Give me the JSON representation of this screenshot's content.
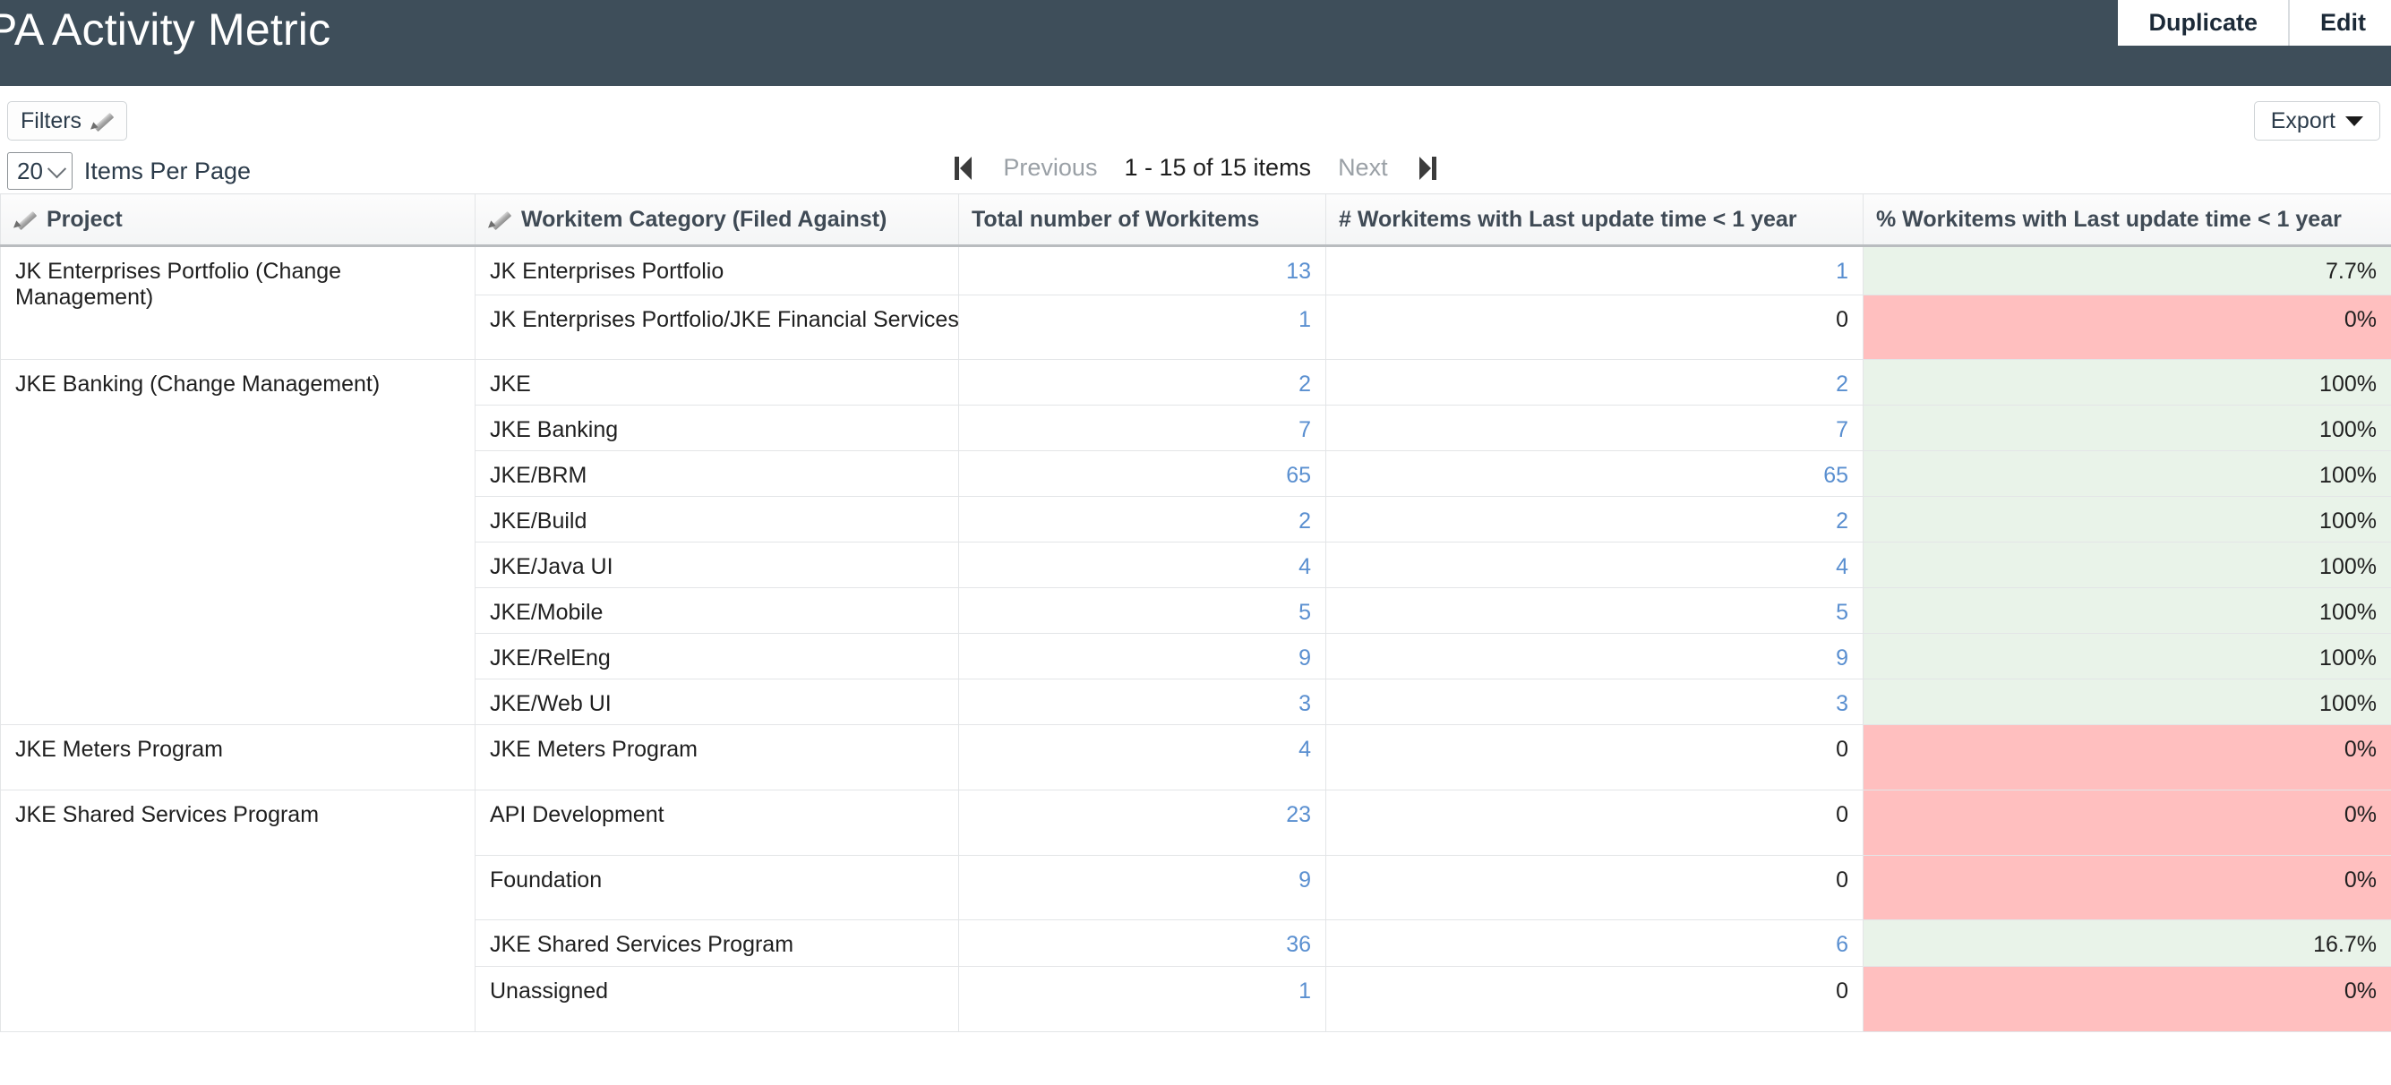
{
  "header": {
    "title": "PA Activity Metric",
    "actions": [
      {
        "label": "Duplicate",
        "name": "duplicate-button"
      },
      {
        "label": "Edit",
        "name": "edit-button"
      }
    ]
  },
  "toolbar": {
    "filters_label": "Filters",
    "filters_icon": "pencil-icon",
    "export_label": "Export",
    "export_icon": "chevron-down-icon",
    "items_per_page_value": "20",
    "items_per_page_label": "Items Per Page"
  },
  "pagination": {
    "first_icon": "first-page-icon",
    "previous_label": "Previous",
    "count_label": "1 - 15 of 15 items",
    "next_label": "Next",
    "last_icon": "last-page-icon"
  },
  "table": {
    "columns": [
      {
        "label": "Project",
        "icon": "pencil-icon",
        "align": "left"
      },
      {
        "label": "Workitem Category (Filed Against)",
        "icon": "pencil-icon",
        "align": "left"
      },
      {
        "label": "Total number of Workitems",
        "icon": null,
        "align": "left"
      },
      {
        "label": "# Workitems with Last update time < 1 year",
        "icon": null,
        "align": "left"
      },
      {
        "label": "% Workitems with Last update time < 1 year",
        "icon": null,
        "align": "left"
      }
    ],
    "colors": {
      "good_bg": "#e9f3e9",
      "bad_bg": "#ffbfbf",
      "link": "#5a8fd0",
      "header_bar": "#3e4e5a"
    },
    "groups": [
      {
        "project": "JK Enterprises Portfolio (Change Management)",
        "rows": [
          {
            "category": "JK Enterprises Portfolio",
            "total": "13",
            "recent": "1",
            "pct": "7.7%",
            "pct_state": "good",
            "height": 55
          },
          {
            "category": "JK Enterprises Portfolio/JKE Financial Services",
            "total": "1",
            "recent": "0",
            "pct": "0%",
            "pct_state": "bad",
            "height": 72
          }
        ]
      },
      {
        "project": "JKE Banking (Change Management)",
        "rows": [
          {
            "category": "JKE",
            "total": "2",
            "recent": "2",
            "pct": "100%",
            "pct_state": "good",
            "height": 51
          },
          {
            "category": "JKE Banking",
            "total": "7",
            "recent": "7",
            "pct": "100%",
            "pct_state": "good",
            "height": 51
          },
          {
            "category": "JKE/BRM",
            "total": "65",
            "recent": "65",
            "pct": "100%",
            "pct_state": "good",
            "height": 51
          },
          {
            "category": "JKE/Build",
            "total": "2",
            "recent": "2",
            "pct": "100%",
            "pct_state": "good",
            "height": 51
          },
          {
            "category": "JKE/Java UI",
            "total": "4",
            "recent": "4",
            "pct": "100%",
            "pct_state": "good",
            "height": 51
          },
          {
            "category": "JKE/Mobile",
            "total": "5",
            "recent": "5",
            "pct": "100%",
            "pct_state": "good",
            "height": 51
          },
          {
            "category": "JKE/RelEng",
            "total": "9",
            "recent": "9",
            "pct": "100%",
            "pct_state": "good",
            "height": 51
          },
          {
            "category": "JKE/Web UI",
            "total": "3",
            "recent": "3",
            "pct": "100%",
            "pct_state": "good",
            "height": 51
          }
        ]
      },
      {
        "project": "JKE Meters Program",
        "rows": [
          {
            "category": "JKE Meters Program",
            "total": "4",
            "recent": "0",
            "pct": "0%",
            "pct_state": "bad",
            "height": 73
          }
        ]
      },
      {
        "project": "JKE Shared Services Program",
        "rows": [
          {
            "category": "API Development",
            "total": "23",
            "recent": "0",
            "pct": "0%",
            "pct_state": "bad",
            "height": 73
          },
          {
            "category": "Foundation",
            "total": "9",
            "recent": "0",
            "pct": "0%",
            "pct_state": "bad",
            "height": 72
          },
          {
            "category": "JKE Shared Services Program",
            "total": "36",
            "recent": "6",
            "pct": "16.7%",
            "pct_state": "good",
            "height": 52
          },
          {
            "category": "Unassigned",
            "total": "1",
            "recent": "0",
            "pct": "0%",
            "pct_state": "bad",
            "height": 73
          }
        ]
      }
    ]
  }
}
